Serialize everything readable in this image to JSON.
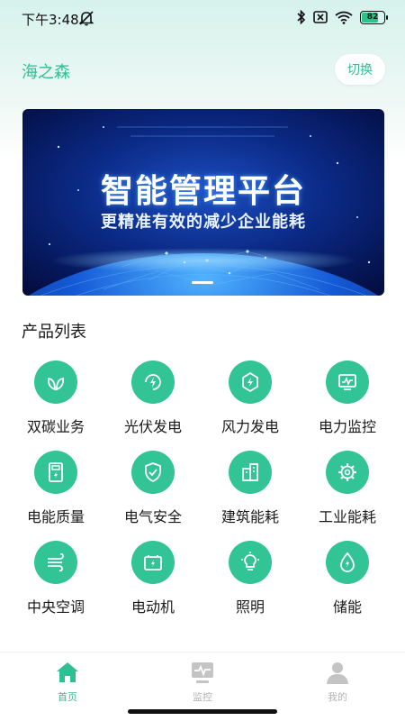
{
  "status_bar": {
    "time": "下午3:48",
    "battery": "82",
    "battery_level": 0.82
  },
  "header": {
    "org_name": "海之森",
    "switch_label": "切换"
  },
  "banner": {
    "title": "智能管理平台",
    "subtitle": "更精准有效的减少企业能耗"
  },
  "products": {
    "title": "产品列表",
    "items": [
      {
        "label": "双碳业务",
        "icon": "leaves-icon"
      },
      {
        "label": "光伏发电",
        "icon": "solar-bolt-icon"
      },
      {
        "label": "风力发电",
        "icon": "wind-bolt-icon"
      },
      {
        "label": "电力监控",
        "icon": "monitor-icon"
      },
      {
        "label": "电能质量",
        "icon": "meter-icon"
      },
      {
        "label": "电气安全",
        "icon": "shield-icon"
      },
      {
        "label": "建筑能耗",
        "icon": "building-icon"
      },
      {
        "label": "工业能耗",
        "icon": "gear-icon"
      },
      {
        "label": "中央空调",
        "icon": "air-icon"
      },
      {
        "label": "电动机",
        "icon": "battery-icon"
      },
      {
        "label": "照明",
        "icon": "bulb-icon"
      },
      {
        "label": "储能",
        "icon": "drop-bolt-icon"
      }
    ]
  },
  "tabs": [
    {
      "label": "首页",
      "active": true
    },
    {
      "label": "监控",
      "active": false
    },
    {
      "label": "我的",
      "active": false
    }
  ],
  "colors": {
    "accent": "#2fbf91",
    "icon_bg": "#33c495",
    "tab_inactive": "#c4c4c4"
  }
}
